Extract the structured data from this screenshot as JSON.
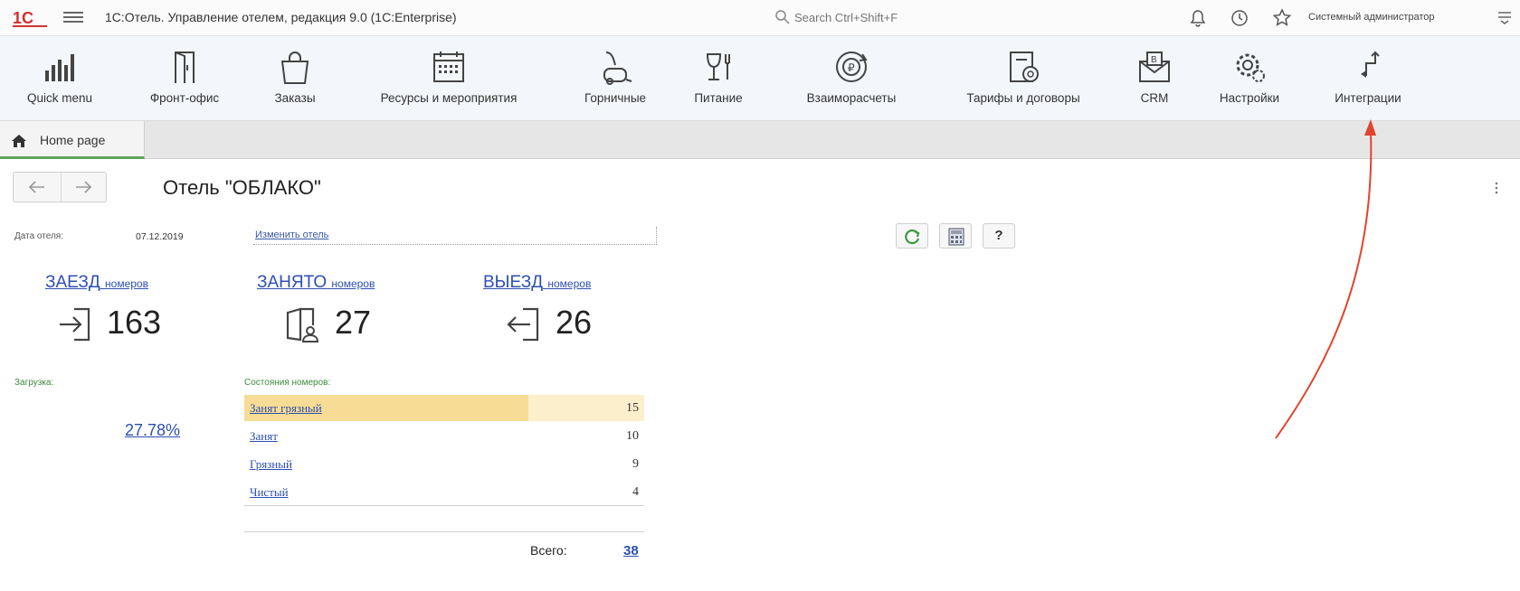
{
  "titlebar": {
    "app_title": "1С:Отель. Управление отелем, редакция 9.0   (1C:Enterprise)",
    "search_placeholder": "Search Ctrl+Shift+F",
    "user_name": "Системный администратор",
    "logo_color": "#d32f2f"
  },
  "sections": [
    {
      "label": "Quick menu",
      "icon": "bar-chart-icon"
    },
    {
      "label": "Фронт-офис",
      "icon": "door-icon"
    },
    {
      "label": "Заказы",
      "icon": "shopping-bag-icon"
    },
    {
      "label": "Ресурсы и мероприятия",
      "icon": "calendar-icon"
    },
    {
      "label": "Горничные",
      "icon": "vacuum-cleaner-icon"
    },
    {
      "label": "Питание",
      "icon": "wine-glass-fork-icon"
    },
    {
      "label": "Взаиморасчеты",
      "icon": "coins-refresh-icon"
    },
    {
      "label": "Тарифы и договоры",
      "icon": "document-coin-icon"
    },
    {
      "label": "CRM",
      "icon": "envelope-icon"
    },
    {
      "label": "Настройки",
      "icon": "gears-icon"
    },
    {
      "label": "Интеграции",
      "icon": "arrows-integration-icon"
    }
  ],
  "tabs": [
    {
      "label": "Home page",
      "icon": "home-icon",
      "active": true
    }
  ],
  "page": {
    "title": "Отель \"ОБЛАКО\"",
    "date_label": "Дата отеля:",
    "date_value": "07.12.2019",
    "change_date_link": "Изменить отель"
  },
  "stats": [
    {
      "title": "ЗАЕЗД",
      "subtitle": "номеров",
      "value": "163",
      "icon": "check-in-icon"
    },
    {
      "title": "ЗАНЯТО",
      "subtitle": "номеров",
      "value": "27",
      "icon": "occupied-room-icon"
    },
    {
      "title": "ВЫЕЗД",
      "subtitle": "номеров",
      "value": "26",
      "icon": "check-out-icon"
    }
  ],
  "load": {
    "label": "Загрузка:",
    "value": "27.78%"
  },
  "room_states": {
    "label": "Состояния номеров:",
    "rows": [
      {
        "name": "Занят грязный",
        "count": "15",
        "fill": 0.71
      },
      {
        "name": "Занят",
        "count": "10",
        "fill": 0
      },
      {
        "name": "Грязный",
        "count": "9",
        "fill": 0
      },
      {
        "name": "Чистый",
        "count": "4",
        "fill": 0
      }
    ],
    "total_label": "Всего:",
    "total_value": "38"
  },
  "colors": {
    "accent_green": "#5ba55a",
    "link_blue": "#2d4fb0",
    "bar_fill": "#f6dc94",
    "bar_fill_light": "#fbefcc",
    "annotation_arrow": "#e0442c"
  }
}
